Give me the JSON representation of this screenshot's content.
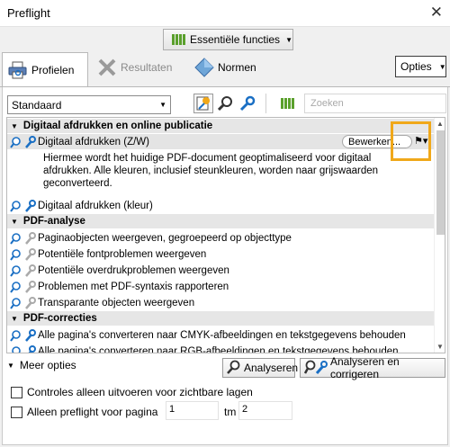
{
  "window": {
    "title": "Preflight",
    "close": "✕"
  },
  "toolbar": {
    "set_label": "Essentiële functies"
  },
  "tabs": [
    {
      "label": "Profielen",
      "active": true
    },
    {
      "label": "Resultaten",
      "active": false
    },
    {
      "label": "Normen",
      "active": false
    }
  ],
  "options_button": "Opties",
  "profile_dropdown": {
    "selected": "Standaard"
  },
  "search": {
    "placeholder": "Zoeken"
  },
  "groups": [
    {
      "label": "Digitaal afdrukken en online publicatie",
      "items": [
        {
          "label": "Digitaal afdrukken (Z/W)",
          "selected": true,
          "edit_label": "Bewerken...",
          "description": "Hiermee wordt het huidige PDF-document geoptimaliseerd voor digitaal afdrukken. Alle kleuren, inclusief steunkleuren, worden naar grijswaarden geconverteerd."
        },
        {
          "label": "Digitaal afdrukken (kleur)"
        }
      ]
    },
    {
      "label": "PDF-analyse",
      "items": [
        {
          "label": "Paginaobjecten weergeven, gegroepeerd op objecttype"
        },
        {
          "label": "Potentiële fontproblemen weergeven"
        },
        {
          "label": "Potentiële overdrukproblemen weergeven"
        },
        {
          "label": "Problemen met PDF-syntaxis rapporteren"
        },
        {
          "label": "Transparante objecten weergeven"
        }
      ]
    },
    {
      "label": "PDF-correcties",
      "items": [
        {
          "label": "Alle pagina's converteren naar CMYK-afbeeldingen en tekstgegevens behouden"
        },
        {
          "label": "Alle pagina's converteren naar RGB-afbeeldingen en tekstgegevens behouden"
        }
      ]
    }
  ],
  "footer": {
    "more_options": "Meer opties",
    "analyze": "Analyseren",
    "analyze_fix": "Analyseren en corrigeren",
    "visible_layers": "Controles alleen uitvoeren voor zichtbare lagen",
    "page_range": "Alleen preflight voor pagina",
    "from": "1",
    "to_label": "tm",
    "to": "2"
  },
  "colors": {
    "accent_green": "#5aa02c",
    "highlight": "#f0a81a",
    "blue": "#1a6fc4"
  }
}
